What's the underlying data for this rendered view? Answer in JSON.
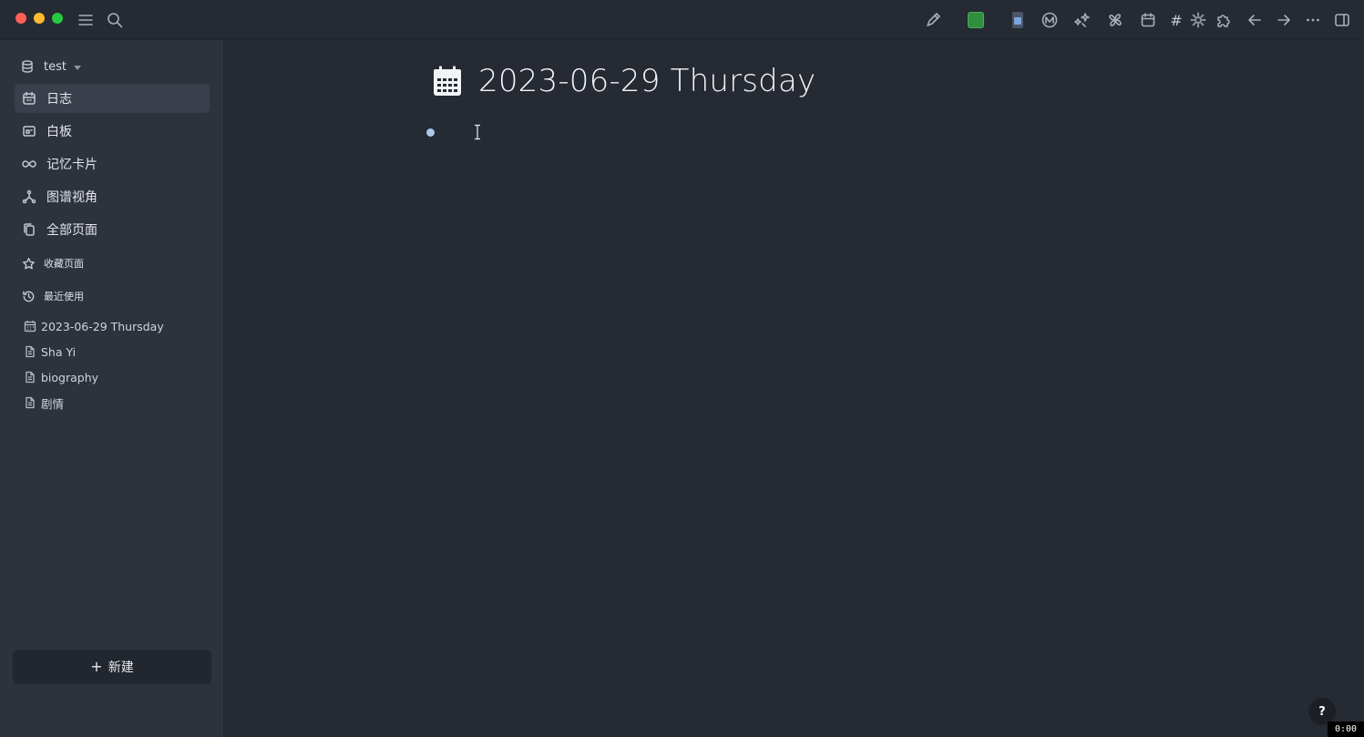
{
  "titlebar": {
    "window_controls": [
      "close",
      "minimize",
      "maximize"
    ],
    "left_icons": [
      "menu-icon",
      "search-icon"
    ],
    "right_icons": [
      "pen-icon",
      "green-square-icon",
      "app-badge-icon",
      "m-logo-icon",
      "stars-icon",
      "pinwheel-icon",
      "calendar-icon",
      "hashtag-icon",
      "gear-icon",
      "puzzle-icon",
      "arrow-left-icon",
      "arrow-right-icon",
      "more-icon",
      "right-sidebar-icon"
    ],
    "hash_label": "#"
  },
  "sidebar": {
    "graph_name": "test",
    "nav": [
      {
        "label": "日志",
        "icon": "calendar-icon",
        "active": true
      },
      {
        "label": "白板",
        "icon": "whiteboard-icon",
        "active": false
      },
      {
        "label": "记忆卡片",
        "icon": "infinity-icon",
        "active": false
      },
      {
        "label": "图谱视角",
        "icon": "graph-icon",
        "active": false
      },
      {
        "label": "全部页面",
        "icon": "pages-icon",
        "active": false
      }
    ],
    "favorites_title": "收藏页面",
    "recent_title": "最近使用",
    "recent": [
      {
        "label": "2023-06-29 Thursday",
        "icon": "calendar-small-icon"
      },
      {
        "label": "Sha Yi",
        "icon": "page-icon"
      },
      {
        "label": "biography",
        "icon": "page-icon"
      },
      {
        "label": "剧情",
        "icon": "page-icon"
      }
    ],
    "new_button": {
      "plus": "+",
      "label": "新建"
    }
  },
  "main": {
    "title": "2023-06-29 Thursday",
    "block_text": ""
  },
  "help_label": "?",
  "timer": "0:00",
  "colors": {
    "background": "#262a33",
    "sidebar": "#2d323c",
    "active_item": "#3a404b",
    "bullet": "#a9c8ea",
    "accent_green": "#2f8f3e"
  }
}
